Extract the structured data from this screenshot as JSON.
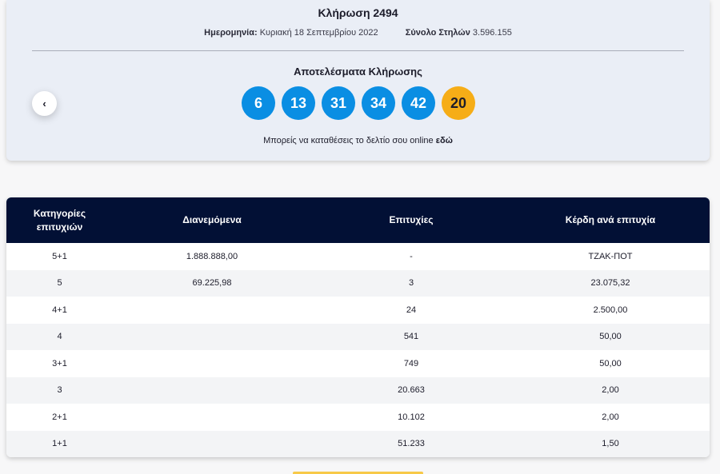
{
  "draw": {
    "title": "Κλήρωση 2494",
    "date_label": "Ημερομηνία:",
    "date_value": "Κυριακή 18 Σεπτεμβρίου 2022",
    "columns_label": "Σύνολο Στηλών",
    "columns_value": "3.596.155",
    "results_title": "Αποτελέσματα Κλήρωσης",
    "prev_icon": "chevron-left-icon",
    "prev_glyph": "‹",
    "balls": [
      "6",
      "13",
      "31",
      "34",
      "42"
    ],
    "joker": "20",
    "online_text": "Μπορείς να καταθέσεις το δελτίο σου online",
    "online_link": "εδώ"
  },
  "colors": {
    "ball_blue": "#0a8ee3",
    "joker_yellow": "#f6ad17",
    "header_navy": "#021035"
  },
  "table": {
    "headers": [
      "Κατηγορίες επιτυχιών",
      "Διανεμόμενα",
      "Επιτυχίες",
      "Κέρδη ανά επιτυχία"
    ],
    "rows": [
      [
        "5+1",
        "1.888.888,00",
        "-",
        "ΤΖΑΚ-ΠΟΤ"
      ],
      [
        "5",
        "69.225,98",
        "3",
        "23.075,32"
      ],
      [
        "4+1",
        "",
        "24",
        "2.500,00"
      ],
      [
        "4",
        "",
        "541",
        "50,00"
      ],
      [
        "3+1",
        "",
        "749",
        "50,00"
      ],
      [
        "3",
        "",
        "20.663",
        "2,00"
      ],
      [
        "2+1",
        "",
        "10.102",
        "2,00"
      ],
      [
        "1+1",
        "",
        "51.233",
        "1,50"
      ]
    ]
  }
}
